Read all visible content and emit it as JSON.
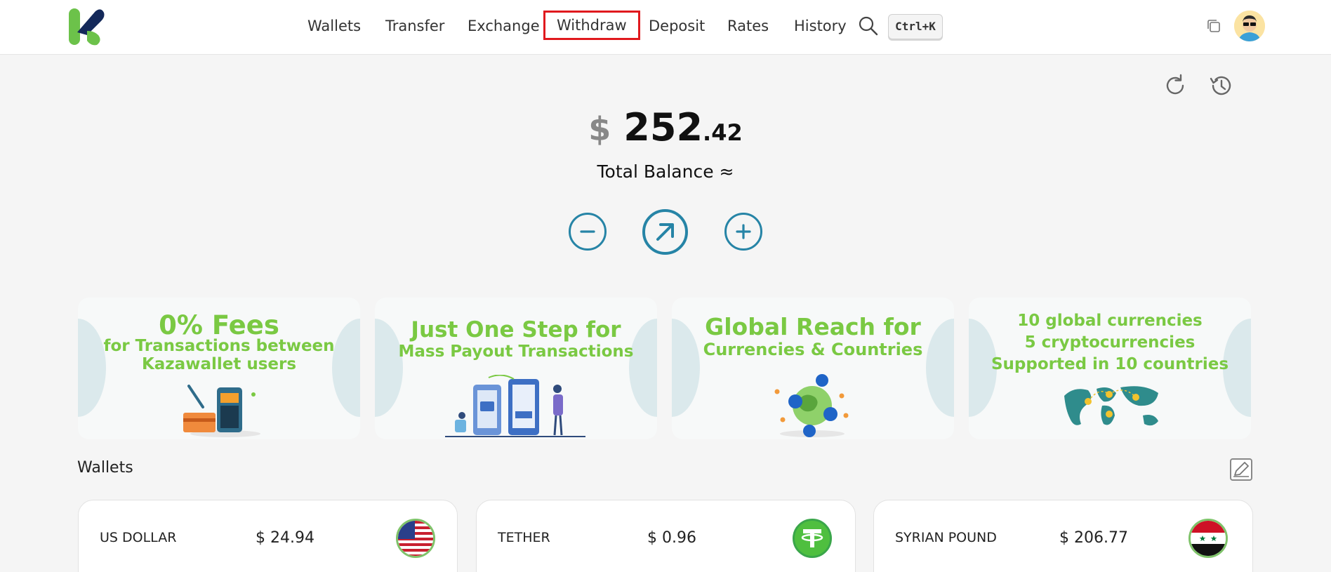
{
  "nav": {
    "items": [
      {
        "label": "Wallets"
      },
      {
        "label": "Transfer"
      },
      {
        "label": "Exchange"
      },
      {
        "label": "Withdraw"
      },
      {
        "label": "Deposit"
      },
      {
        "label": "Rates"
      },
      {
        "label": "History"
      }
    ],
    "active": "Withdraw",
    "shortcut": "Ctrl+K"
  },
  "balance": {
    "currency_symbol": "$",
    "integer": "252",
    "decimal": ".42",
    "label": "Total Balance ≈"
  },
  "actions": [
    {
      "icon": "minus-circle-icon"
    },
    {
      "icon": "arrow-up-right-circle-icon"
    },
    {
      "icon": "plus-circle-icon"
    }
  ],
  "banners": [
    {
      "line1": "0% Fees",
      "line2": "for Transactions between",
      "line3": "Kazawallet users"
    },
    {
      "line1": "Just One Step for",
      "line2": "Mass Payout Transactions"
    },
    {
      "line1": "Global Reach for",
      "line2": "Currencies & Countries"
    },
    {
      "line1": "10 global currencies",
      "line2": "5 cryptocurrencies",
      "line3": "Supported in 10 countries"
    }
  ],
  "wallets": {
    "title": "Wallets",
    "items": [
      {
        "name": "US DOLLAR",
        "amount": "$ 24.94",
        "icon": "us-flag-icon"
      },
      {
        "name": "TETHER",
        "amount": "$ 0.96",
        "icon": "tether-icon"
      },
      {
        "name": "SYRIAN POUND",
        "amount": "$ 206.77",
        "icon": "syria-flag-icon"
      }
    ]
  },
  "colors": {
    "accent": "#2684a6",
    "brand_green": "#7ac943",
    "brand_navy": "#14295a",
    "highlight": "#e0191e"
  }
}
